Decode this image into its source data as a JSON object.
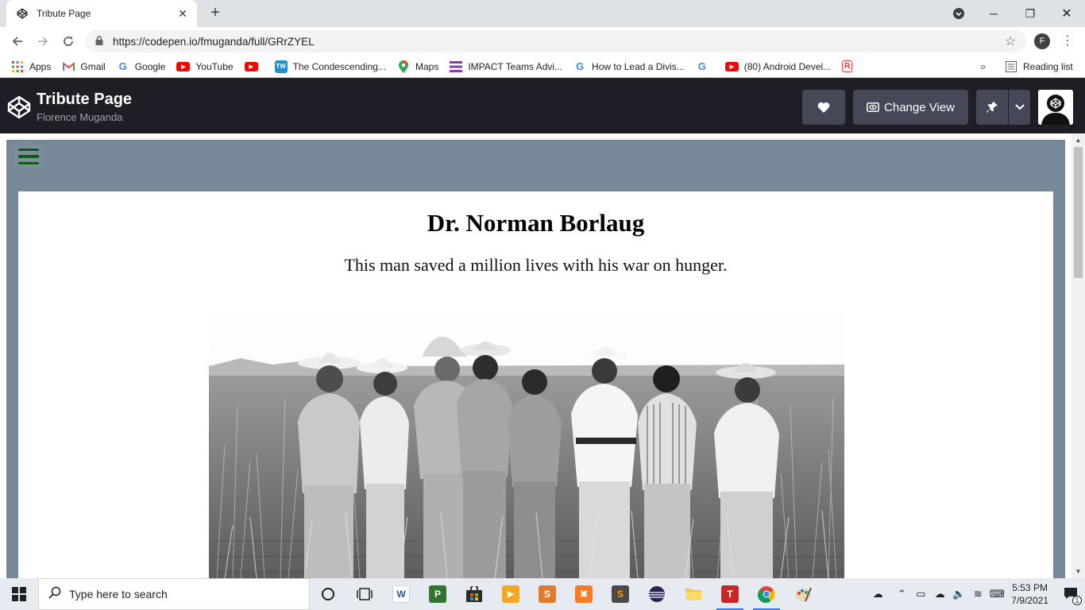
{
  "browser": {
    "tab_title": "Tribute Page",
    "url": "https://codepen.io/fmuganda/full/GRrZYEL",
    "profile_initial": "F",
    "bookmarks": [
      {
        "label": "Apps",
        "icon": "apps-grid-icon"
      },
      {
        "label": "Gmail",
        "icon": "gmail-icon"
      },
      {
        "label": "Google",
        "icon": "google-icon"
      },
      {
        "label": "YouTube",
        "icon": "youtube-icon"
      },
      {
        "label": "",
        "icon": "youtube-icon"
      },
      {
        "label": "The Condescending...",
        "icon": "tw-icon"
      },
      {
        "label": "Maps",
        "icon": "maps-icon"
      },
      {
        "label": "IMPACT Teams Advi...",
        "icon": "list-icon"
      },
      {
        "label": "How to Lead a Divis...",
        "icon": "google-icon"
      },
      {
        "label": "",
        "icon": "google-icon"
      },
      {
        "label": "(80) Android Devel...",
        "icon": "youtube-icon"
      },
      {
        "label": "",
        "icon": "r-icon"
      }
    ],
    "more_bookmarks": "»",
    "reading_list": "Reading list"
  },
  "codepen": {
    "pen_title": "Tribute Page",
    "author": "Florence Muganda",
    "change_view_label": "Change View"
  },
  "page": {
    "headline": "Dr. Norman Borlaug",
    "tagline": "This man saved a million lives with his war on hunger."
  },
  "taskbar": {
    "search_placeholder": "Type here to search",
    "time": "5:53 PM",
    "date": "7/9/2021",
    "notification_count": "1"
  }
}
